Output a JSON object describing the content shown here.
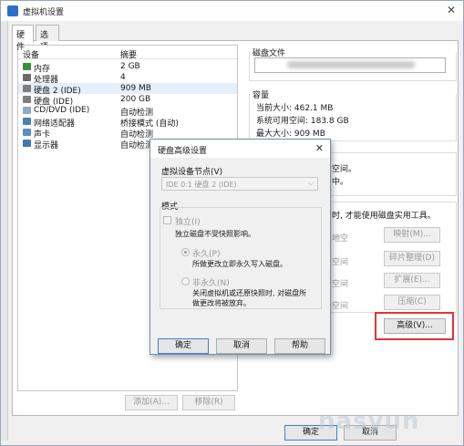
{
  "window": {
    "title": "虚拟机设置"
  },
  "tabs": [
    {
      "label": "硬件"
    },
    {
      "label": "选项"
    }
  ],
  "device_list": {
    "col_device": "设备",
    "col_summary": "摘要",
    "rows": [
      {
        "name": "内存",
        "summary": "2 GB",
        "icon": "memory-icon",
        "color": "#3b8e3b"
      },
      {
        "name": "处理器",
        "summary": "4",
        "icon": "cpu-icon",
        "color": "#6a6a6a"
      },
      {
        "name": "硬盘 2 (IDE)",
        "summary": "909 MB",
        "icon": "hard-disk-icon",
        "color": "#7d7d7d"
      },
      {
        "name": "硬盘 (IDE)",
        "summary": "200 GB",
        "icon": "hard-disk-icon",
        "color": "#7d7d7d"
      },
      {
        "name": "CD/DVD (IDE)",
        "summary": "自动检测",
        "icon": "cd-dvd-icon",
        "color": "#8fa9c9"
      },
      {
        "name": "网络适配器",
        "summary": "桥接模式 (自动)",
        "icon": "network-adapter-icon",
        "color": "#4e7fb0"
      },
      {
        "name": "声卡",
        "summary": "自动检测",
        "icon": "sound-card-icon",
        "color": "#5a8fc8"
      },
      {
        "name": "显示器",
        "summary": "自动检测",
        "icon": "monitor-icon",
        "color": "#3f79b8"
      }
    ]
  },
  "device_buttons": {
    "add": "添加(A)...",
    "remove": "移除(R)"
  },
  "disk_file": {
    "label": "磁盘文件"
  },
  "capacity": {
    "label": "容量",
    "current": "当前大小: 462.1 MB",
    "free": "系统可用空间: 183.8 GB",
    "max": "最大大小: 909 MB"
  },
  "right_partial": {
    "space_line": "空间。",
    "medium_line": "中。",
    "tool_line": "时, 才能使用磁盘实用工具。",
    "row1": "地空",
    "row2": "空间",
    "row3": "空间",
    "row4": "空间"
  },
  "right_buttons": {
    "map": "映射(M)...",
    "defrag": "碎片整理(D)",
    "expand": "扩展(E)...",
    "compact": "压缩(C)",
    "advanced": "高级(V)..."
  },
  "bottom_buttons": {
    "ok": "确定",
    "cancel": "取消"
  },
  "dialog": {
    "title": "硬盘高级设置",
    "node_label": "虚拟设备节点(V)",
    "node_value": "IDE 0:1  硬盘 2 (IDE)",
    "mode_label": "模式",
    "independent_label": "独立(I)",
    "independent_desc": "独立磁盘不受快照影响。",
    "persistent_label": "永久(P)",
    "persistent_desc": "所做更改立即永久写入磁盘。",
    "nonpersistent_label": "非永久(N)",
    "nonpersistent_desc1": "关闭虚拟机或还原快照时, 对磁盘所",
    "nonpersistent_desc2": "做更改将被放弃。",
    "ok": "确定",
    "cancel": "取消",
    "help": "帮助"
  },
  "watermark": "nasyun"
}
